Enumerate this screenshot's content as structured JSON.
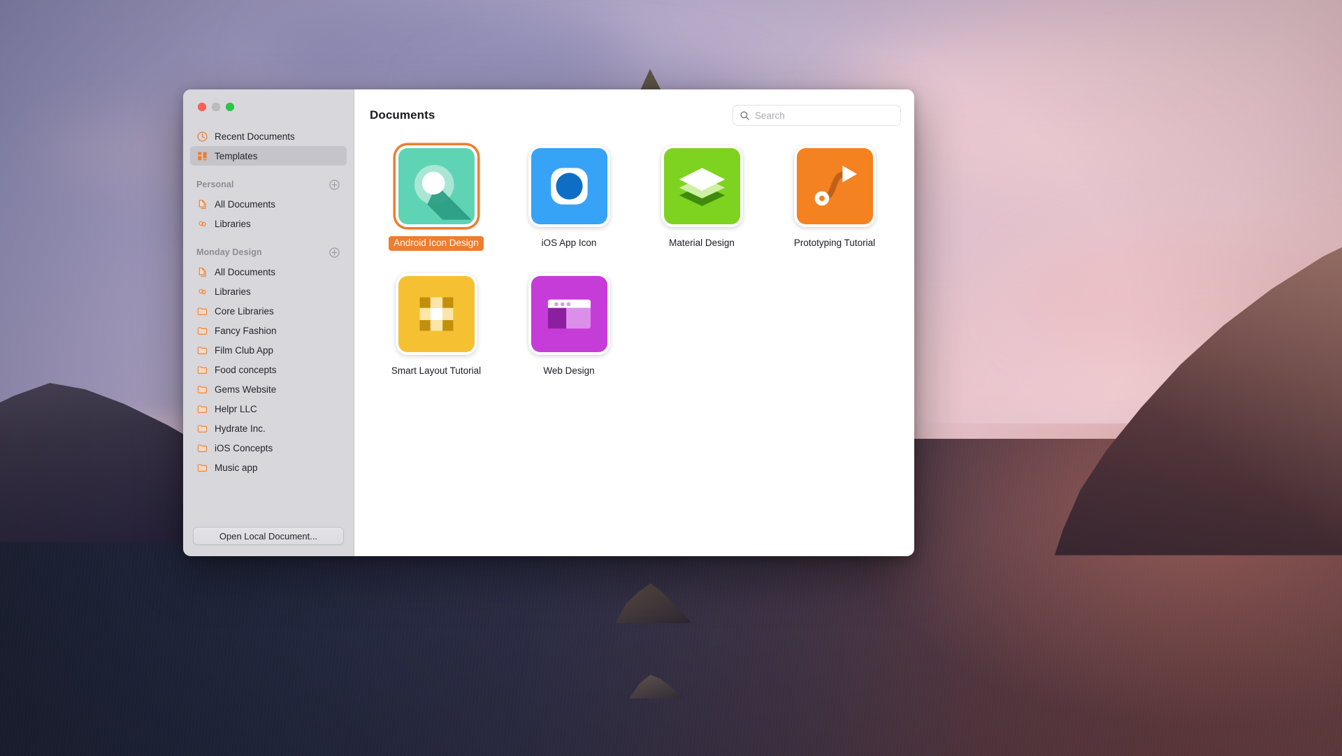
{
  "window": {
    "traffic_lights": [
      {
        "name": "close",
        "color": "#ff5f57"
      },
      {
        "name": "minimize",
        "color": "#bdbdbd"
      },
      {
        "name": "zoom",
        "color": "#28c840"
      }
    ]
  },
  "sidebar": {
    "top_items": [
      {
        "label": "Recent Documents",
        "icon": "clock-icon",
        "selected": false
      },
      {
        "label": "Templates",
        "icon": "grid-icon",
        "selected": true
      }
    ],
    "sections": [
      {
        "title": "Personal",
        "add_button": "add-icon",
        "items": [
          {
            "label": "All Documents",
            "icon": "documents-icon"
          },
          {
            "label": "Libraries",
            "icon": "libraries-icon"
          }
        ]
      },
      {
        "title": "Monday Design",
        "add_button": "add-icon",
        "items": [
          {
            "label": "All Documents",
            "icon": "documents-icon"
          },
          {
            "label": "Libraries",
            "icon": "libraries-icon"
          },
          {
            "label": "Core Libraries",
            "icon": "folder-icon"
          },
          {
            "label": "Fancy Fashion",
            "icon": "folder-icon"
          },
          {
            "label": "Film Club App",
            "icon": "folder-icon"
          },
          {
            "label": "Food concepts",
            "icon": "folder-icon"
          },
          {
            "label": "Gems Website",
            "icon": "folder-icon"
          },
          {
            "label": "Helpr LLC",
            "icon": "folder-icon"
          },
          {
            "label": "Hydrate Inc.",
            "icon": "folder-icon"
          },
          {
            "label": "iOS Concepts",
            "icon": "folder-icon"
          },
          {
            "label": "Music app",
            "icon": "folder-icon"
          }
        ]
      }
    ],
    "footer_button": "Open Local Document..."
  },
  "content": {
    "title": "Documents",
    "search": {
      "placeholder": "Search",
      "value": "",
      "icon": "search-icon"
    },
    "templates": [
      {
        "label": "Android Icon Design",
        "selected": true,
        "icon": "android-icon",
        "bg": "#5fd4b5"
      },
      {
        "label": "iOS App Icon",
        "selected": false,
        "icon": "ios-app-icon",
        "bg": "#36a3f7"
      },
      {
        "label": "Material Design",
        "selected": false,
        "icon": "layers-icon",
        "bg": "#7ed321"
      },
      {
        "label": "Prototyping Tutorial",
        "selected": false,
        "icon": "prototype-icon",
        "bg": "#f58220"
      },
      {
        "label": "Smart Layout Tutorial",
        "selected": false,
        "icon": "smart-layout-icon",
        "bg": "#f5c132"
      },
      {
        "label": "Web Design",
        "selected": false,
        "icon": "browser-icon",
        "bg": "#c63cd8"
      }
    ]
  },
  "colors": {
    "accent_orange": "#ed7d31",
    "sidebar_bg": "#d8d7dc",
    "selection_bg": "#c5c4ca",
    "content_bg": "#ffffff"
  }
}
